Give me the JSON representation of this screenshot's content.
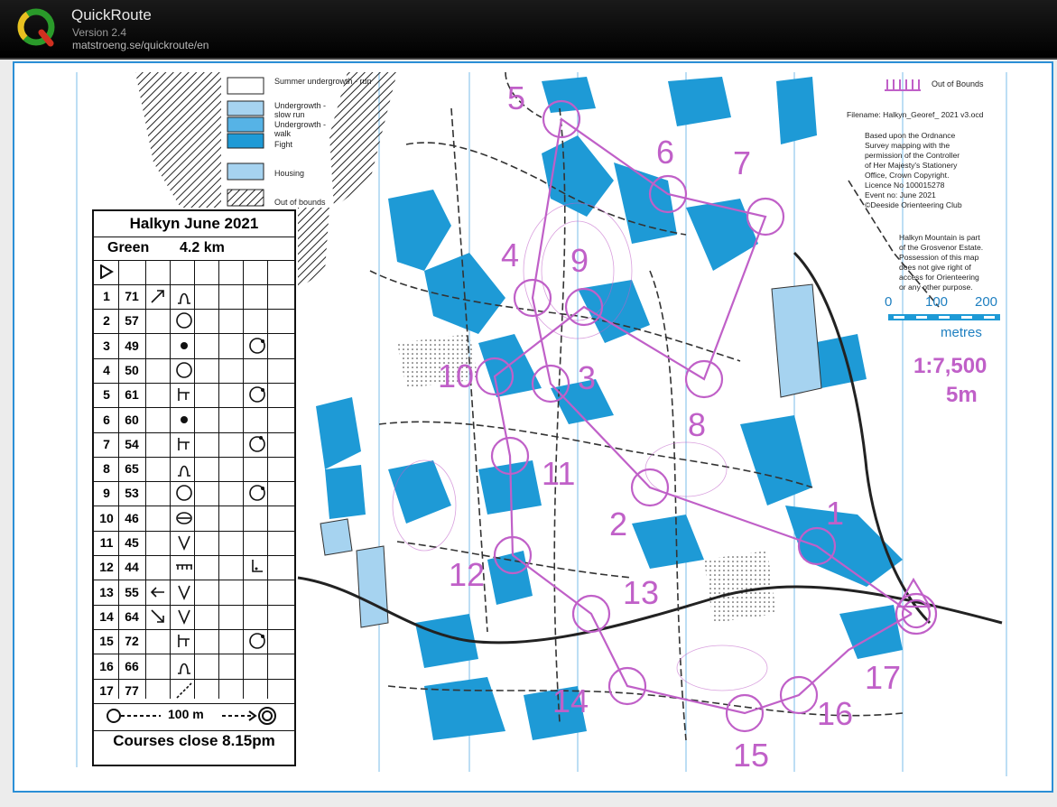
{
  "app": {
    "title": "QuickRoute",
    "version": "Version 2.4",
    "url": "matstroeng.se/quickroute/en"
  },
  "legend": [
    {
      "label": "Summer undergrowth - run"
    },
    {
      "label": "Undergrowth - slow run"
    },
    {
      "label": "Undergrowth - walk"
    },
    {
      "label": "Fight"
    },
    {
      "label": "Housing"
    },
    {
      "label": "Out of bounds"
    }
  ],
  "out_of_bounds_label": "Out of Bounds",
  "info": {
    "filename": "Filename:   Halkyn_Georef_ 2021 v3.ocd",
    "copyright": [
      "Based upon the Ordnance",
      "Survey mapping with the",
      "permission of the Controller",
      "of Her Majesty's Stationery",
      "Office, Crown Copyright.",
      "Licence No  100015278",
      "Event no: June 2021",
      "©Deeside Orienteering Club"
    ],
    "estate": [
      "Halkyn Mountain is part",
      "of the Grosvenor Estate.",
      "Possession of this map",
      "does not give right of",
      "access for Orienteering",
      "or any other purpose."
    ]
  },
  "scale": {
    "ticks": [
      "0",
      "100",
      "200"
    ],
    "unit": "metres",
    "ratio": "1:7,500",
    "contour": "5m"
  },
  "card": {
    "title": "Halkyn June 2021",
    "course": "Green",
    "length": "4.2 km",
    "controls": [
      {
        "n": "1",
        "code": "71"
      },
      {
        "n": "2",
        "code": "57"
      },
      {
        "n": "3",
        "code": "49"
      },
      {
        "n": "4",
        "code": "50"
      },
      {
        "n": "5",
        "code": "61"
      },
      {
        "n": "6",
        "code": "60"
      },
      {
        "n": "7",
        "code": "54"
      },
      {
        "n": "8",
        "code": "65"
      },
      {
        "n": "9",
        "code": "53"
      },
      {
        "n": "10",
        "code": "46"
      },
      {
        "n": "11",
        "code": "45"
      },
      {
        "n": "12",
        "code": "44"
      },
      {
        "n": "13",
        "code": "55"
      },
      {
        "n": "14",
        "code": "64"
      },
      {
        "n": "15",
        "code": "72"
      },
      {
        "n": "16",
        "code": "66"
      },
      {
        "n": "17",
        "code": "77"
      }
    ],
    "finish_distance": "100 m",
    "close": "Courses close 8.15pm"
  },
  "map_numbers": [
    "1",
    "2",
    "3",
    "4",
    "5",
    "6",
    "7",
    "8",
    "9",
    "10",
    "11",
    "12",
    "13",
    "14",
    "15",
    "16",
    "17"
  ],
  "colors": {
    "purple": "#c060c8",
    "blue": "#1e9ad6",
    "lightblue": "#a6d3f0"
  }
}
